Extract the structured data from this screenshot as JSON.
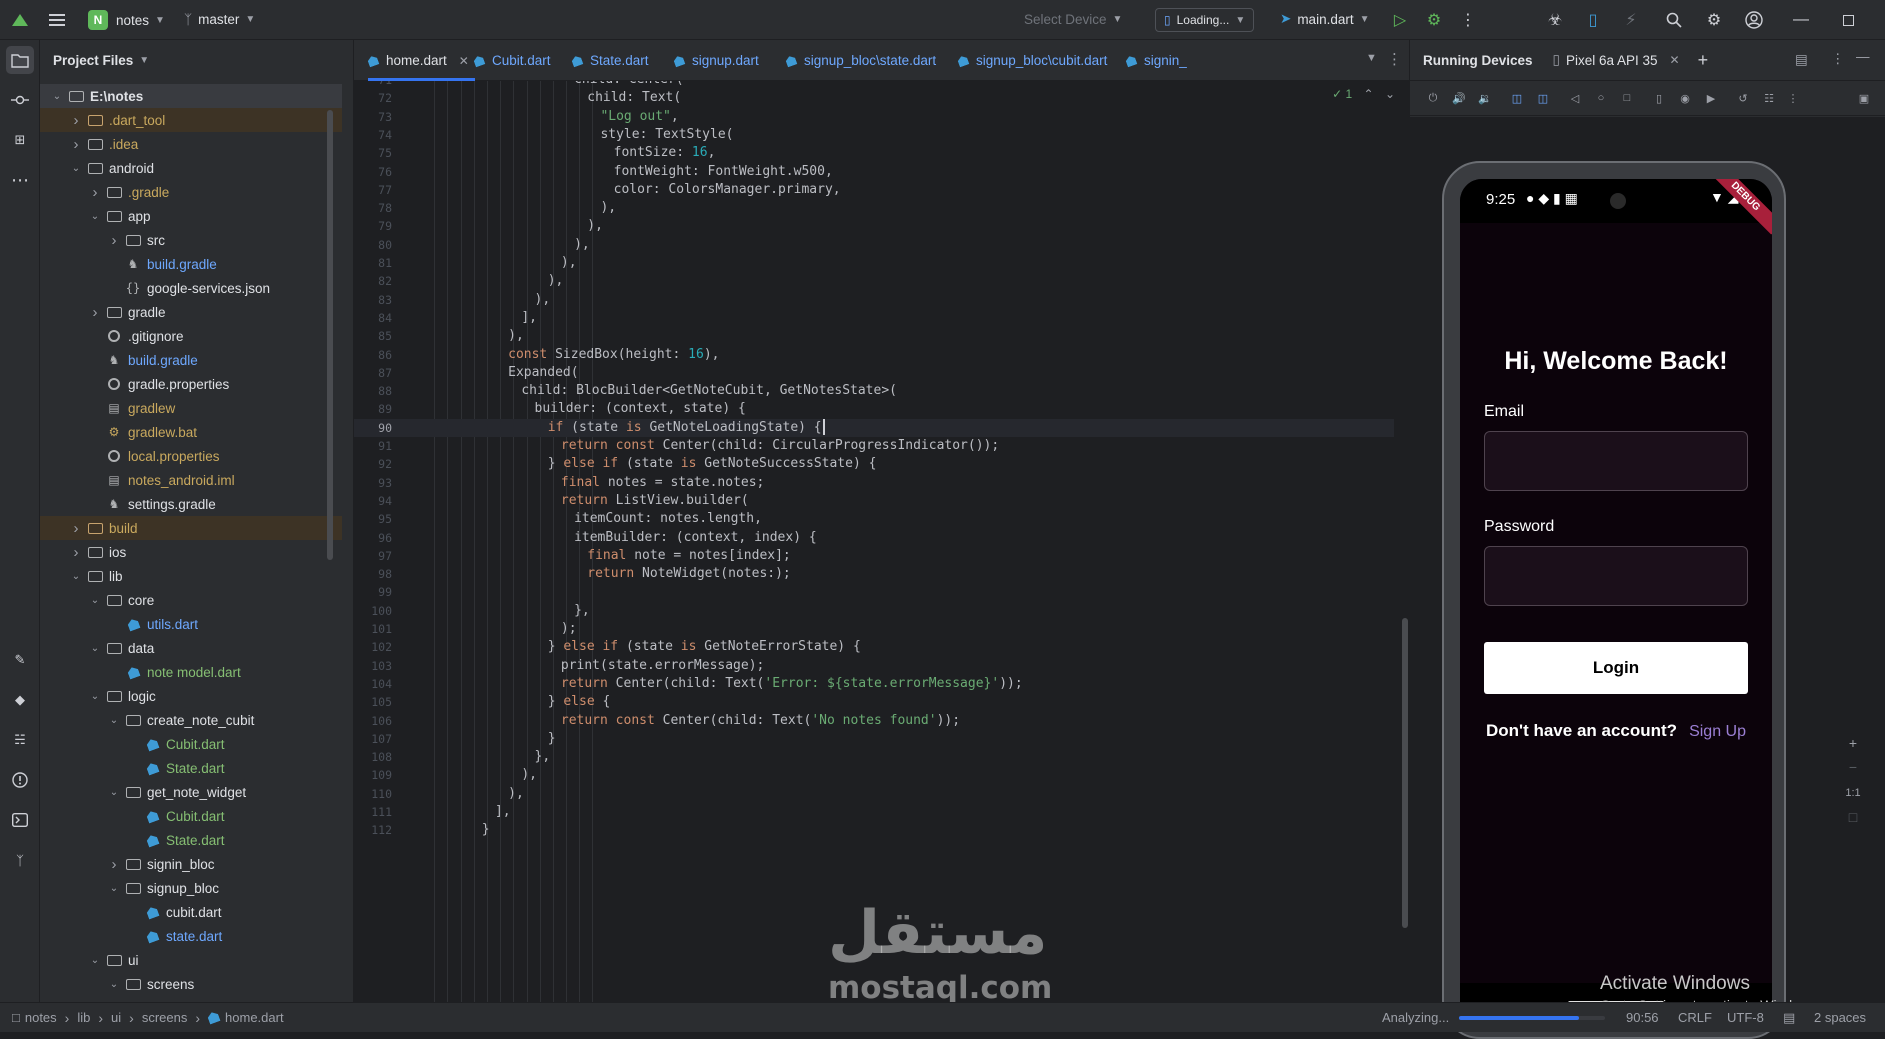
{
  "titlebar": {
    "project_initial": "N",
    "project_name": "notes",
    "branch": "master",
    "device_selector": "Select Device",
    "loading_selector": "Loading...",
    "run_config": "main.dart"
  },
  "project_panel": {
    "title": "Project Files",
    "rows": [
      {
        "label": "E:\\notes",
        "indent": 0,
        "arrow": "v",
        "icon": "module",
        "color": "default",
        "bg": "sel"
      },
      {
        "label": ".dart_tool",
        "indent": 1,
        "arrow": ">",
        "icon": "folder-orange",
        "color": "yellow",
        "bg": "excluded"
      },
      {
        "label": ".idea",
        "indent": 1,
        "arrow": ">",
        "icon": "folder",
        "color": "yellow",
        "bg": ""
      },
      {
        "label": "android",
        "indent": 1,
        "arrow": "v",
        "icon": "folder",
        "color": "default",
        "bg": ""
      },
      {
        "label": ".gradle",
        "indent": 2,
        "arrow": ">",
        "icon": "folder",
        "color": "yellow",
        "bg": ""
      },
      {
        "label": "app",
        "indent": 2,
        "arrow": "v",
        "icon": "folder",
        "color": "default",
        "bg": ""
      },
      {
        "label": "src",
        "indent": 3,
        "arrow": ">",
        "icon": "folder",
        "color": "default",
        "bg": ""
      },
      {
        "label": "build.gradle",
        "indent": 3,
        "arrow": "",
        "icon": "gradle",
        "color": "blue",
        "bg": ""
      },
      {
        "label": "google-services.json",
        "indent": 3,
        "arrow": "",
        "icon": "json",
        "color": "default",
        "bg": ""
      },
      {
        "label": "gradle",
        "indent": 2,
        "arrow": ">",
        "icon": "folder",
        "color": "default",
        "bg": ""
      },
      {
        "label": ".gitignore",
        "indent": 2,
        "arrow": "",
        "icon": "ignore",
        "color": "default",
        "bg": ""
      },
      {
        "label": "build.gradle",
        "indent": 2,
        "arrow": "",
        "icon": "gradle",
        "color": "blue",
        "bg": ""
      },
      {
        "label": "gradle.properties",
        "indent": 2,
        "arrow": "",
        "icon": "gear",
        "color": "default",
        "bg": ""
      },
      {
        "label": "gradlew",
        "indent": 2,
        "arrow": "",
        "icon": "file",
        "color": "yellow",
        "bg": ""
      },
      {
        "label": "gradlew.bat",
        "indent": 2,
        "arrow": "",
        "icon": "bat",
        "color": "yellow",
        "bg": ""
      },
      {
        "label": "local.properties",
        "indent": 2,
        "arrow": "",
        "icon": "gear",
        "color": "yellow",
        "bg": ""
      },
      {
        "label": "notes_android.iml",
        "indent": 2,
        "arrow": "",
        "icon": "file",
        "color": "yellow",
        "bg": ""
      },
      {
        "label": "settings.gradle",
        "indent": 2,
        "arrow": "",
        "icon": "gradle",
        "color": "default",
        "bg": ""
      },
      {
        "label": "build",
        "indent": 1,
        "arrow": ">",
        "icon": "folder-orange",
        "color": "yellow",
        "bg": "excluded"
      },
      {
        "label": "ios",
        "indent": 1,
        "arrow": ">",
        "icon": "folder",
        "color": "default",
        "bg": ""
      },
      {
        "label": "lib",
        "indent": 1,
        "arrow": "v",
        "icon": "folder",
        "color": "default",
        "bg": ""
      },
      {
        "label": "core",
        "indent": 2,
        "arrow": "v",
        "icon": "folder",
        "color": "default",
        "bg": ""
      },
      {
        "label": "utils.dart",
        "indent": 3,
        "arrow": "",
        "icon": "dart",
        "color": "blue",
        "bg": ""
      },
      {
        "label": "data",
        "indent": 2,
        "arrow": "v",
        "icon": "folder",
        "color": "default",
        "bg": ""
      },
      {
        "label": "note model.dart",
        "indent": 3,
        "arrow": "",
        "icon": "dart",
        "color": "green",
        "bg": ""
      },
      {
        "label": "logic",
        "indent": 2,
        "arrow": "v",
        "icon": "folder",
        "color": "default",
        "bg": ""
      },
      {
        "label": "create_note_cubit",
        "indent": 3,
        "arrow": "v",
        "icon": "folder",
        "color": "default",
        "bg": ""
      },
      {
        "label": "Cubit.dart",
        "indent": 4,
        "arrow": "",
        "icon": "dart",
        "color": "green",
        "bg": ""
      },
      {
        "label": "State.dart",
        "indent": 4,
        "arrow": "",
        "icon": "dart",
        "color": "green",
        "bg": ""
      },
      {
        "label": "get_note_widget",
        "indent": 3,
        "arrow": "v",
        "icon": "folder",
        "color": "default",
        "bg": ""
      },
      {
        "label": "Cubit.dart",
        "indent": 4,
        "arrow": "",
        "icon": "dart",
        "color": "green",
        "bg": ""
      },
      {
        "label": "State.dart",
        "indent": 4,
        "arrow": "",
        "icon": "dart",
        "color": "green",
        "bg": ""
      },
      {
        "label": "signin_bloc",
        "indent": 3,
        "arrow": ">",
        "icon": "folder",
        "color": "default",
        "bg": ""
      },
      {
        "label": "signup_bloc",
        "indent": 3,
        "arrow": "v",
        "icon": "folder",
        "color": "default",
        "bg": ""
      },
      {
        "label": "cubit.dart",
        "indent": 4,
        "arrow": "",
        "icon": "dart",
        "color": "default",
        "bg": ""
      },
      {
        "label": "state.dart",
        "indent": 4,
        "arrow": "",
        "icon": "dart",
        "color": "blue",
        "bg": ""
      },
      {
        "label": "ui",
        "indent": 2,
        "arrow": "v",
        "icon": "folder",
        "color": "default",
        "bg": ""
      },
      {
        "label": "screens",
        "indent": 3,
        "arrow": "v",
        "icon": "folder",
        "color": "default",
        "bg": ""
      }
    ]
  },
  "editor_tabs": [
    {
      "label": "home.dart",
      "active": true,
      "closable": true
    },
    {
      "label": "Cubit.dart",
      "active": false,
      "closable": false
    },
    {
      "label": "State.dart",
      "active": false,
      "closable": false
    },
    {
      "label": "signup.dart",
      "active": false,
      "closable": false
    },
    {
      "label": "signup_bloc\\state.dart",
      "active": false,
      "closable": false
    },
    {
      "label": "signup_bloc\\cubit.dart",
      "active": false,
      "closable": false
    },
    {
      "label": "signin_",
      "active": false,
      "closable": false
    }
  ],
  "editor": {
    "inspection": "✓ 1",
    "current_line": 90,
    "lines": [
      {
        "n": 71,
        "ind": 12,
        "code": "child: Center("
      },
      {
        "n": 72,
        "ind": 13,
        "code": "child: Text("
      },
      {
        "n": 73,
        "ind": 14,
        "code": "\"Log out\","
      },
      {
        "n": 74,
        "ind": 14,
        "code": "style: TextStyle("
      },
      {
        "n": 75,
        "ind": 15,
        "code": "fontSize: 16,"
      },
      {
        "n": 76,
        "ind": 15,
        "code": "fontWeight: FontWeight.w500,"
      },
      {
        "n": 77,
        "ind": 15,
        "code": "color: ColorsManager.primary,"
      },
      {
        "n": 78,
        "ind": 14,
        "code": "),"
      },
      {
        "n": 79,
        "ind": 13,
        "code": "),"
      },
      {
        "n": 80,
        "ind": 12,
        "code": "),"
      },
      {
        "n": 81,
        "ind": 11,
        "code": "),"
      },
      {
        "n": 82,
        "ind": 10,
        "code": "),"
      },
      {
        "n": 83,
        "ind": 9,
        "code": "),"
      },
      {
        "n": 84,
        "ind": 8,
        "code": "],"
      },
      {
        "n": 85,
        "ind": 7,
        "code": "),"
      },
      {
        "n": 86,
        "ind": 7,
        "code": "const SizedBox(height: 16),"
      },
      {
        "n": 87,
        "ind": 7,
        "code": "Expanded("
      },
      {
        "n": 88,
        "ind": 8,
        "code": "child: BlocBuilder<GetNoteCubit, GetNotesState>("
      },
      {
        "n": 89,
        "ind": 9,
        "code": "builder: (context, state) {"
      },
      {
        "n": 90,
        "ind": 10,
        "code": "if (state is GetNoteLoadingState) {"
      },
      {
        "n": 91,
        "ind": 11,
        "code": "return const Center(child: CircularProgressIndicator());"
      },
      {
        "n": 92,
        "ind": 10,
        "code": "} else if (state is GetNoteSuccessState) {"
      },
      {
        "n": 93,
        "ind": 11,
        "code": "final notes = state.notes;"
      },
      {
        "n": 94,
        "ind": 11,
        "code": "return ListView.builder("
      },
      {
        "n": 95,
        "ind": 12,
        "code": "itemCount: notes.length,"
      },
      {
        "n": 96,
        "ind": 12,
        "code": "itemBuilder: (context, index) {"
      },
      {
        "n": 97,
        "ind": 13,
        "code": "final note = notes[index];"
      },
      {
        "n": 98,
        "ind": 13,
        "code": "return NoteWidget(notes:);"
      },
      {
        "n": 99,
        "ind": 13,
        "code": ""
      },
      {
        "n": 100,
        "ind": 12,
        "code": "},"
      },
      {
        "n": 101,
        "ind": 11,
        "code": ");"
      },
      {
        "n": 102,
        "ind": 10,
        "code": "} else if (state is GetNoteErrorState) {"
      },
      {
        "n": 103,
        "ind": 11,
        "code": "print(state.errorMessage);"
      },
      {
        "n": 104,
        "ind": 11,
        "code": "return Center(child: Text('Error: ${state.errorMessage}'));"
      },
      {
        "n": 105,
        "ind": 10,
        "code": "} else {"
      },
      {
        "n": 106,
        "ind": 11,
        "code": "return const Center(child: Text('No notes found'));"
      },
      {
        "n": 107,
        "ind": 10,
        "code": "}"
      },
      {
        "n": 108,
        "ind": 9,
        "code": "},"
      },
      {
        "n": 109,
        "ind": 8,
        "code": "),"
      },
      {
        "n": 110,
        "ind": 7,
        "code": "),"
      },
      {
        "n": 111,
        "ind": 6,
        "code": "],"
      },
      {
        "n": 112,
        "ind": 5,
        "code": "}"
      }
    ]
  },
  "running_devices": {
    "title": "Running Devices",
    "device_tab": "Pixel 6a API 35"
  },
  "phone": {
    "time": "9:25",
    "debug_label": "DEBUG",
    "title": "Hi, Welcome Back!",
    "email_label": "Email",
    "password_label": "Password",
    "login_button": "Login",
    "no_account": "Don't have an account?",
    "sign_up": "Sign Up",
    "activate_title": "Activate Windows",
    "activate_sub": "Go to Settings to activate Windows."
  },
  "zoom": {
    "plus": "+",
    "minus": "−",
    "ratio": "1:1"
  },
  "statusbar": {
    "crumbs": [
      "notes",
      "lib",
      "ui",
      "screens",
      "home.dart"
    ],
    "analyzing": "Analyzing...",
    "progress_fraction": 0.82,
    "position": "90:56",
    "line_sep": "CRLF",
    "encoding": "UTF-8",
    "indent": "2 spaces"
  },
  "watermark": {
    "arabic": "مستقل",
    "latin": "mostaql.com"
  }
}
